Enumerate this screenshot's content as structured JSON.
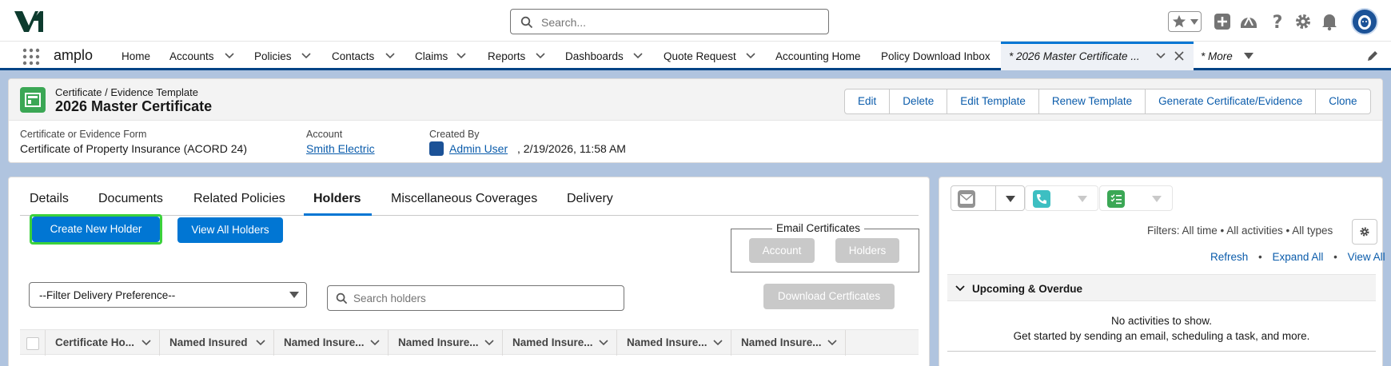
{
  "header": {
    "search_placeholder": "Search..."
  },
  "nav": {
    "app_name": "amplo",
    "items": [
      "Home",
      "Accounts",
      "Policies",
      "Contacts",
      "Claims",
      "Reports",
      "Dashboards",
      "Quote Request",
      "Accounting Home",
      "Policy Download Inbox"
    ],
    "active_tab": "* 2026 Master Certificate ...",
    "more": "* More"
  },
  "record": {
    "object_type": "Certificate / Evidence Template",
    "title": "2026 Master Certificate",
    "actions": [
      "Edit",
      "Delete",
      "Edit Template",
      "Renew Template",
      "Generate Certificate/Evidence",
      "Clone"
    ],
    "fields": {
      "form_label": "Certificate or Evidence Form",
      "form_value": "Certificate of Property Insurance (ACORD 24)",
      "account_label": "Account",
      "account_value": "Smith Electric",
      "created_label": "Created By",
      "created_user": "Admin User",
      "created_date": ", 2/19/2026, 11:58 AM"
    }
  },
  "main": {
    "tabs": [
      "Details",
      "Documents",
      "Related Policies",
      "Holders",
      "Miscellaneous Coverages",
      "Delivery"
    ],
    "active_tab": "Holders",
    "create_holder": "Create New Holder",
    "view_holders": "View All Holders",
    "email_title": "Email Certificates",
    "email_account": "Account",
    "email_holders": "Holders",
    "filter_select": "--Filter Delivery Preference--",
    "search_placeholder": "Search holders",
    "download": "Download Certficates",
    "columns": [
      "Certificate Ho...",
      "Named Insured",
      "Named Insure...",
      "Named Insure...",
      "Named Insure...",
      "Named Insure...",
      "Named Insure..."
    ]
  },
  "side": {
    "filters": "Filters: All time • All activities • All types",
    "links": [
      "Refresh",
      "Expand All",
      "View All"
    ],
    "upcoming": "Upcoming & Overdue",
    "no_activity_1": "No activities to show.",
    "no_activity_2": "Get started by sending an email, scheduling a task, and more."
  },
  "colors": {
    "brand": "#0176d3",
    "nav_border": "#014486",
    "record_icon": "#3ba755",
    "email_icon": "#939393",
    "call_icon": "#48c3cc",
    "task_icon": "#3ba755"
  }
}
